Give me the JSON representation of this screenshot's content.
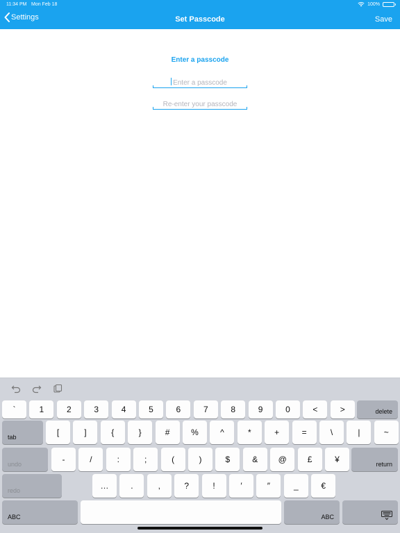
{
  "status_bar": {
    "time": "11:34 PM",
    "date": "Mon Feb 18",
    "battery": "100%",
    "battery_level": 1.0
  },
  "nav": {
    "back_label": "Settings",
    "title": "Set Passcode",
    "save_label": "Save"
  },
  "form": {
    "prompt": "Enter a passcode",
    "field1_placeholder": "Enter a passcode",
    "field2_placeholder": "Re-enter your passcode"
  },
  "keyboard": {
    "row1": [
      "`",
      "1",
      "2",
      "3",
      "4",
      "5",
      "6",
      "7",
      "8",
      "9",
      "0",
      "<",
      ">"
    ],
    "row1_end": "delete",
    "row2_start": "tab",
    "row2": [
      "[",
      "]",
      "{",
      "}",
      "#",
      "%",
      "^",
      "*",
      "+",
      "=",
      "\\",
      "|",
      "~"
    ],
    "row3_start": "undo",
    "row3": [
      "-",
      "/",
      ":",
      ";",
      "(",
      ")",
      "$",
      "&",
      "@",
      "£",
      "¥"
    ],
    "row3_end": "return",
    "row4_start": "redo",
    "row4": [
      "…",
      ".",
      ",",
      "?",
      "!",
      "′",
      "″",
      "_",
      "€"
    ],
    "row5_left": "ABC",
    "row5_right": "ABC",
    "colors": {
      "accent": "#1aa3ef",
      "keyboard_bg": "#d1d4db",
      "key": "#fdfdfd",
      "fn_key": "#adb1ba"
    }
  }
}
